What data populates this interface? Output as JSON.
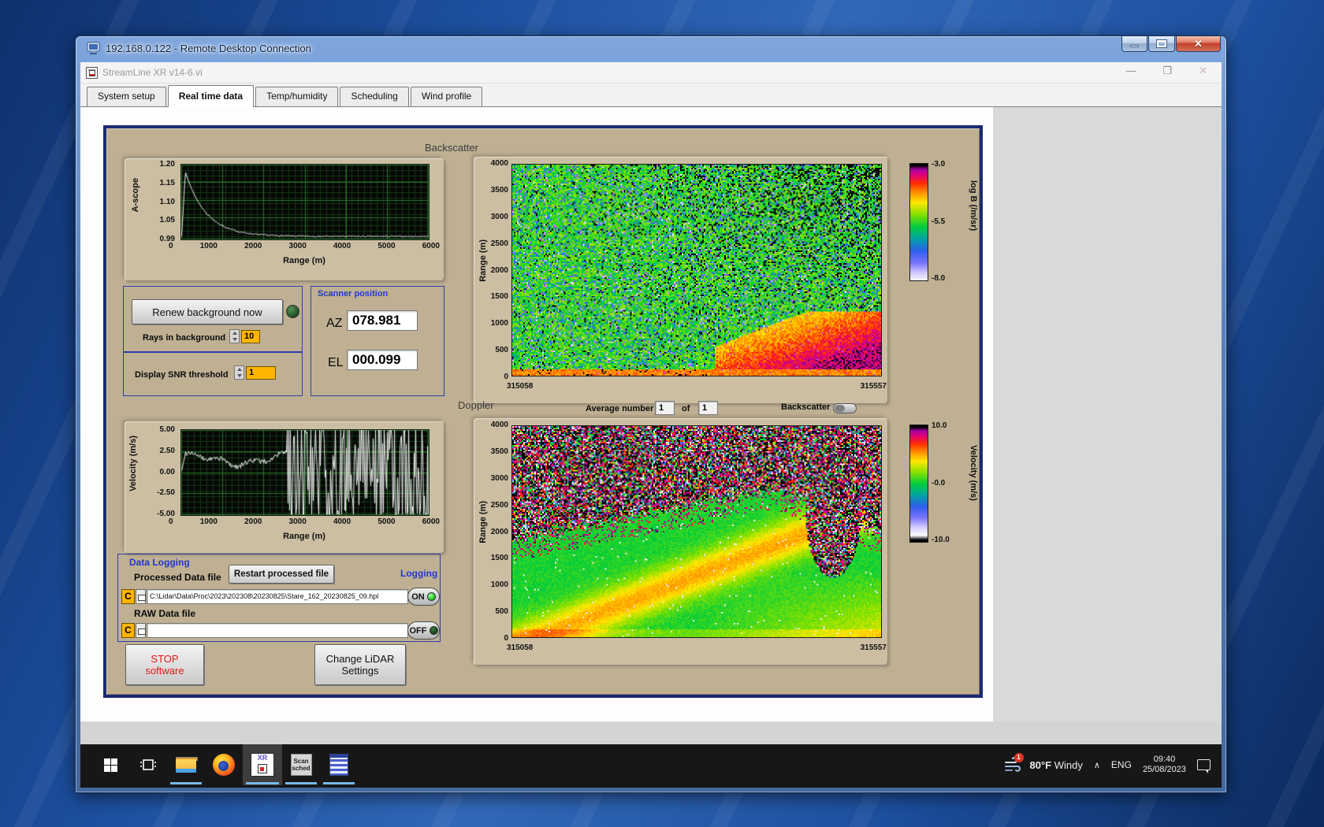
{
  "rdp": {
    "title": "192.168.0.122 - Remote Desktop Connection"
  },
  "app": {
    "title": "StreamLine XR v14-6.vi"
  },
  "tabs": [
    {
      "label": "System setup"
    },
    {
      "label": "Real time data"
    },
    {
      "label": "Temp/humidity"
    },
    {
      "label": "Scheduling"
    },
    {
      "label": "Wind profile"
    }
  ],
  "ascope": {
    "ylabel": "A-scope",
    "xlabel": "Range (m)",
    "yticks": [
      "1.20",
      "1.15",
      "1.10",
      "1.05",
      "0.99"
    ],
    "xticks": [
      "0",
      "1000",
      "2000",
      "3000",
      "4000",
      "5000",
      "6000"
    ]
  },
  "background_ctrl": {
    "renew": "Renew background now",
    "rays_label": "Rays in background",
    "rays_value": "10",
    "snr_label": "Display SNR threshold",
    "snr_value": "1"
  },
  "scanner": {
    "title": "Scanner position",
    "az_label": "AZ",
    "az_value": "078.981",
    "el_label": "EL",
    "el_value": "000.099"
  },
  "backscatter": {
    "title": "Backscatter",
    "ylabel": "Range (m)",
    "yticks": [
      "4000",
      "3500",
      "3000",
      "2500",
      "2000",
      "1500",
      "1000",
      "500",
      "0"
    ],
    "x_start": "315058",
    "x_end": "315557",
    "cbar_ticks": [
      "-3.0",
      "-5.5",
      "-8.0"
    ],
    "cbar_label": "log B (/m/sr)"
  },
  "doppler": {
    "title": "Doppler",
    "avg_label": "Average number",
    "avg_value": "1",
    "of": "of",
    "avg_total": "1",
    "toggle_label": "Backscatter",
    "ylabel": "Range (m)",
    "yticks": [
      "4000",
      "3500",
      "3000",
      "2500",
      "2000",
      "1500",
      "1000",
      "500",
      "0"
    ],
    "x_start": "315058",
    "x_end": "315557",
    "cbar_ticks": [
      "10.0",
      "-0.0",
      "-10.0"
    ],
    "cbar_label": "Velocity (m/s)"
  },
  "velocity": {
    "ylabel": "Velocity (m/s)",
    "xlabel": "Range (m)",
    "yticks": [
      "5.00",
      "2.50",
      "0.00",
      "-2.50",
      "-5.00"
    ],
    "xticks": [
      "0",
      "1000",
      "2000",
      "3000",
      "4000",
      "5000",
      "6000"
    ]
  },
  "logging": {
    "title": "Data Logging",
    "processed_label": "Processed Data file",
    "restart": "Restart processed file",
    "logging_label": "Logging",
    "drive": "C",
    "processed_path": "C:\\Lidar\\Data\\Proc\\2023\\202308\\20230825\\Stare_162_20230825_09.hpl",
    "raw_label": "RAW Data file",
    "raw_path": "",
    "on": "ON",
    "off": "OFF"
  },
  "actions": {
    "stop_line1": "STOP",
    "stop_line2": "software",
    "change_line1": "Change LiDAR",
    "change_line2": "Settings"
  },
  "taskbar": {
    "xr_label": "XR",
    "scan_line1": "Scan",
    "scan_line2": "sched",
    "temp": "80°F",
    "weather": "Windy",
    "badge": "1",
    "chevron": "∧",
    "lang": "ENG",
    "time": "09:40",
    "date": "25/08/2023"
  }
}
